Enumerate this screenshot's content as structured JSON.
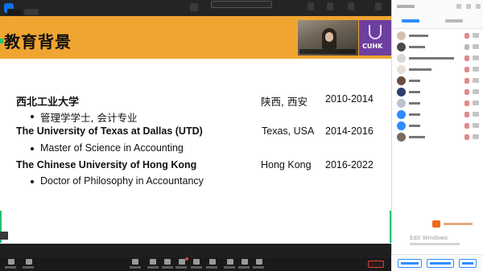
{
  "colors": {
    "header_orange": "#f0a531",
    "cuhk_purple": "#6d3fa0",
    "accent_green": "#1ec46b",
    "zoom_blue": "#2d8cff",
    "end_red": "#e0433b",
    "watermark_orange": "#f06a1d"
  },
  "slide": {
    "title": "教育背景",
    "logo_text": "CUHK",
    "entries": [
      {
        "university": "西北工业大学",
        "location": "陕西, 西安",
        "years": "2010-2014",
        "degree": "管理学学士, 会计专业"
      },
      {
        "university": "The University of Texas at Dallas (UTD)",
        "location": "Texas, USA",
        "years": "2014-2016",
        "degree": "Master of Science in Accounting"
      },
      {
        "university": "The Chinese University of Hong Kong",
        "location": "Hong Kong",
        "years": "2016-2022",
        "degree": "Doctor of Philosophy in Accountancy"
      }
    ]
  },
  "panel": {
    "watermark": "Edit Windows"
  },
  "icons": [
    "app-icon",
    "camera-feed",
    "cuhk-crest",
    "mic-icon",
    "camera-icon",
    "participants-icon",
    "share-icon",
    "chat-icon",
    "record-icon",
    "reactions-icon",
    "more-icon"
  ]
}
